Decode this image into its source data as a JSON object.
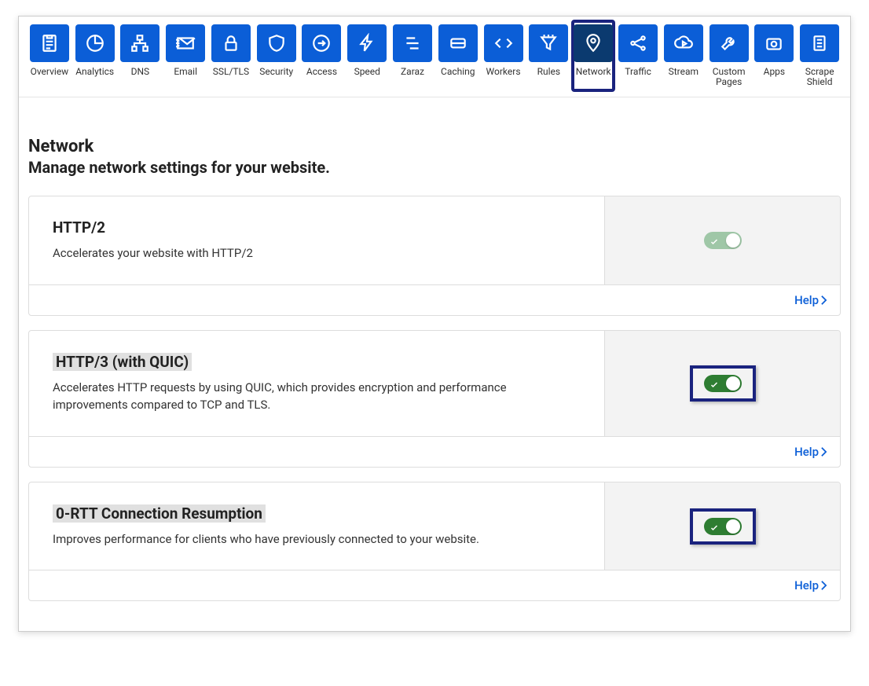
{
  "nav": [
    {
      "id": "overview",
      "label": "Overview"
    },
    {
      "id": "analytics",
      "label": "Analytics"
    },
    {
      "id": "dns",
      "label": "DNS"
    },
    {
      "id": "email",
      "label": "Email"
    },
    {
      "id": "ssltls",
      "label": "SSL/TLS"
    },
    {
      "id": "security",
      "label": "Security"
    },
    {
      "id": "access",
      "label": "Access"
    },
    {
      "id": "speed",
      "label": "Speed"
    },
    {
      "id": "zaraz",
      "label": "Zaraz"
    },
    {
      "id": "caching",
      "label": "Caching"
    },
    {
      "id": "workers",
      "label": "Workers"
    },
    {
      "id": "rules",
      "label": "Rules"
    },
    {
      "id": "network",
      "label": "Network"
    },
    {
      "id": "traffic",
      "label": "Traffic"
    },
    {
      "id": "stream",
      "label": "Stream"
    },
    {
      "id": "custompages",
      "label": "Custom Pages"
    },
    {
      "id": "apps",
      "label": "Apps"
    },
    {
      "id": "scrapeshield",
      "label": "Scrape Shield"
    }
  ],
  "page": {
    "title": "Network",
    "subtitle": "Manage network settings for your website."
  },
  "cards": [
    {
      "title": "HTTP/2",
      "desc": "Accelerates your website with HTTP/2",
      "help": "Help",
      "highlightTitle": false,
      "toggleHighlight": false,
      "toggleStyle": "pale"
    },
    {
      "title": "HTTP/3 (with QUIC)",
      "desc": "Accelerates HTTP requests by using QUIC, which provides encryption and performance improvements compared to TCP and TLS.",
      "help": "Help",
      "highlightTitle": true,
      "toggleHighlight": true,
      "toggleStyle": "strong"
    },
    {
      "title": "0-RTT Connection Resumption",
      "desc": "Improves performance for clients who have previously connected to your website.",
      "help": "Help",
      "highlightTitle": true,
      "toggleHighlight": true,
      "toggleStyle": "strong"
    }
  ]
}
